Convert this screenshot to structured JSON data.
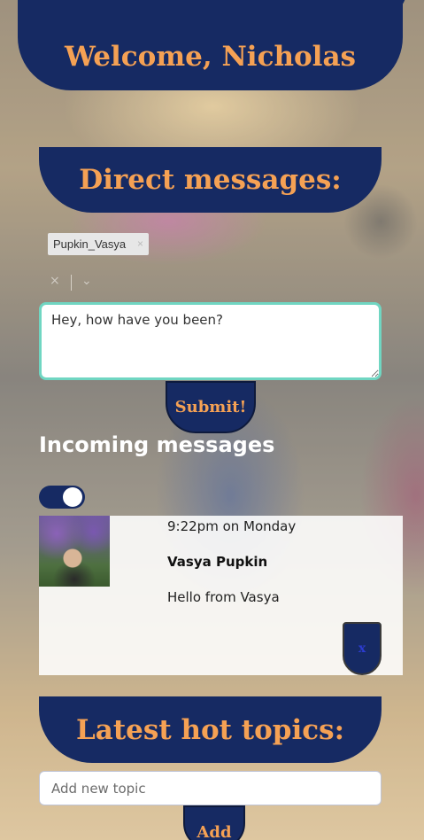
{
  "header": {
    "welcome_text": "Welcome, Nicholas"
  },
  "direct_messages": {
    "title": "Direct messages:",
    "recipient_tag": "Pupkin_Vasya",
    "tag_remove_icon": "close-icon",
    "clear_icon": "×",
    "dropdown_icon": "⌄",
    "message_value": "Hey, how have you been?",
    "submit_label": "Submit!"
  },
  "incoming": {
    "title": "Incoming messages",
    "toggle_on": true,
    "messages": [
      {
        "time": "9:22pm on Monday",
        "sender": "Vasya Pupkin",
        "text": "Hello from Vasya",
        "delete_label": "x"
      }
    ]
  },
  "hot_topics": {
    "title": "Latest hot topics:",
    "input_placeholder": "Add new topic",
    "add_label": "Add"
  },
  "colors": {
    "navy": "#162a63",
    "orange": "#f5a154",
    "focus_border": "#70d6c2"
  }
}
